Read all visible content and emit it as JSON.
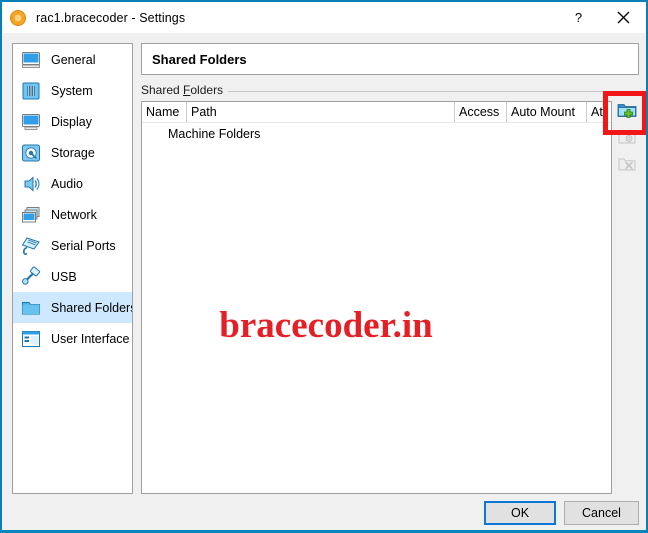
{
  "window": {
    "title": "rac1.bracecoder - Settings",
    "app_icon": "virtualbox-icon",
    "help_label": "?",
    "close_label": "✕",
    "border_color": "#0a7fb5"
  },
  "sidebar": {
    "items": [
      {
        "label": "General",
        "icon": "monitor-icon",
        "selected": false
      },
      {
        "label": "System",
        "icon": "motherboard-icon",
        "selected": false
      },
      {
        "label": "Display",
        "icon": "display-icon",
        "selected": false
      },
      {
        "label": "Storage",
        "icon": "harddisk-icon",
        "selected": false
      },
      {
        "label": "Audio",
        "icon": "speaker-icon",
        "selected": false
      },
      {
        "label": "Network",
        "icon": "network-cards-icon",
        "selected": false
      },
      {
        "label": "Serial Ports",
        "icon": "serial-port-icon",
        "selected": false
      },
      {
        "label": "USB",
        "icon": "usb-plug-icon",
        "selected": false
      },
      {
        "label": "Shared Folders",
        "icon": "folder-icon",
        "selected": true
      },
      {
        "label": "User Interface",
        "icon": "window-layout-icon",
        "selected": false
      }
    ],
    "selection_color": "#cde8ff"
  },
  "main": {
    "header_title": "Shared Folders",
    "group_label_prefix": "Shared ",
    "group_label_mnemonic": "F",
    "group_label_suffix": "olders",
    "table": {
      "columns": [
        "Name",
        "Path",
        "Access",
        "Auto Mount",
        "At"
      ],
      "rows": [
        {
          "node": "Machine Folders",
          "type": "group"
        }
      ]
    },
    "toolbar": [
      {
        "name": "add-shared-folder",
        "icon": "folder-add-icon",
        "enabled": true,
        "highlighted": true
      },
      {
        "name": "edit-shared-folder",
        "icon": "folder-edit-icon",
        "enabled": false,
        "highlighted": false
      },
      {
        "name": "remove-shared-folder",
        "icon": "folder-remove-icon",
        "enabled": false,
        "highlighted": false
      }
    ],
    "highlight_color": "#f21717"
  },
  "watermark": {
    "text": "bracecoder.in",
    "color": "#e41f26"
  },
  "footer": {
    "ok_label": "OK",
    "cancel_label": "Cancel",
    "focus_color": "#0a78d4"
  }
}
